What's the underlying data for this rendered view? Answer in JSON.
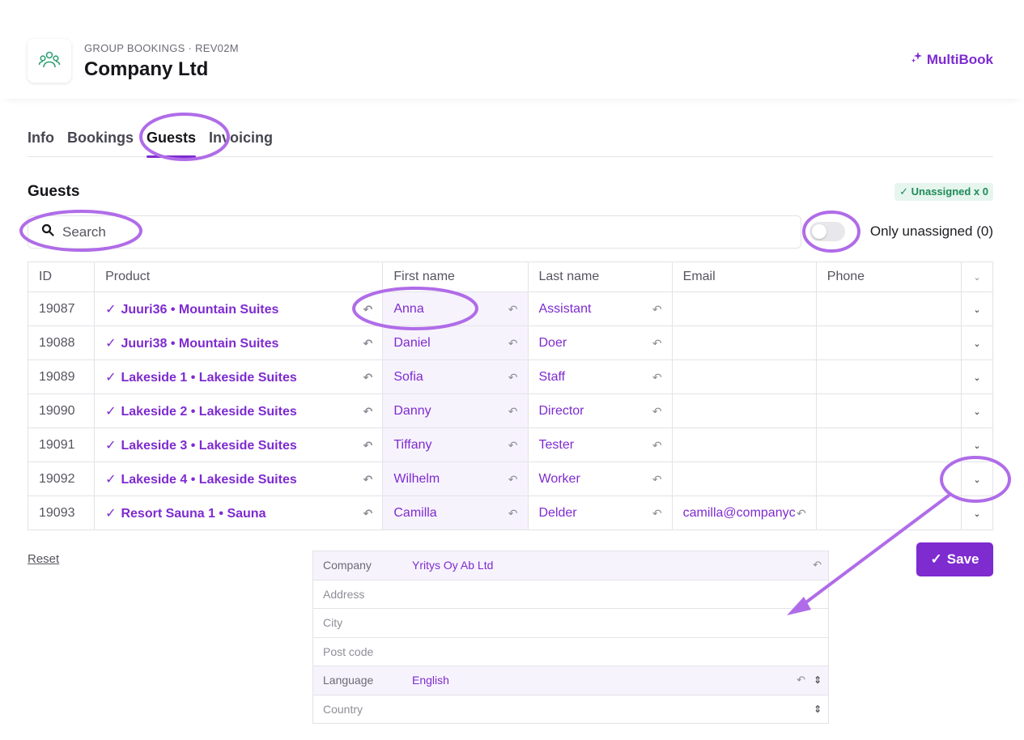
{
  "header": {
    "breadcrumb": "GROUP BOOKINGS · REV02M",
    "title": "Company Ltd",
    "brand": "MultiBook"
  },
  "tabs": [
    {
      "label": "Info"
    },
    {
      "label": "Bookings"
    },
    {
      "label": "Guests"
    },
    {
      "label": "Invoicing"
    }
  ],
  "section": {
    "title": "Guests",
    "badge": "✓ Unassigned x 0"
  },
  "search": {
    "placeholder": "Search"
  },
  "filter": {
    "label": "Only unassigned (0)"
  },
  "table": {
    "headers": [
      "ID",
      "Product",
      "First name",
      "Last name",
      "Email",
      "Phone"
    ],
    "rows": [
      {
        "id": "19087",
        "product": "Juuri36 • Mountain Suites",
        "first": "Anna",
        "last": "Assistant",
        "email": "",
        "phone": ""
      },
      {
        "id": "19088",
        "product": "Juuri38 • Mountain Suites",
        "first": "Daniel",
        "last": "Doer",
        "email": "",
        "phone": ""
      },
      {
        "id": "19089",
        "product": "Lakeside 1 • Lakeside Suites",
        "first": "Sofia",
        "last": "Staff",
        "email": "",
        "phone": ""
      },
      {
        "id": "19090",
        "product": "Lakeside 2 • Lakeside Suites",
        "first": "Danny",
        "last": "Director",
        "email": "",
        "phone": ""
      },
      {
        "id": "19091",
        "product": "Lakeside 3 • Lakeside Suites",
        "first": "Tiffany",
        "last": "Tester",
        "email": "",
        "phone": ""
      },
      {
        "id": "19092",
        "product": "Lakeside 4 • Lakeside Suites",
        "first": "Wilhelm",
        "last": "Worker",
        "email": "",
        "phone": ""
      },
      {
        "id": "19093",
        "product": "Resort Sauna 1 • Sauna",
        "first": "Camilla",
        "last": "Delder",
        "email": "camilla@companyc",
        "phone": ""
      }
    ]
  },
  "actions": {
    "reset": "Reset",
    "save": "Save"
  },
  "details": [
    {
      "label": "Company",
      "value": "Yritys Oy Ab Ltd"
    },
    {
      "label": "Address",
      "value": ""
    },
    {
      "label": "City",
      "value": ""
    },
    {
      "label": "Post code",
      "value": ""
    },
    {
      "label": "Language",
      "value": "English"
    },
    {
      "label": "Country",
      "value": ""
    }
  ],
  "colors": {
    "accent": "#7e2bd0",
    "annotation": "#b06ce8",
    "badge_bg": "#e6f6ee",
    "badge_text": "#1f8a57"
  }
}
